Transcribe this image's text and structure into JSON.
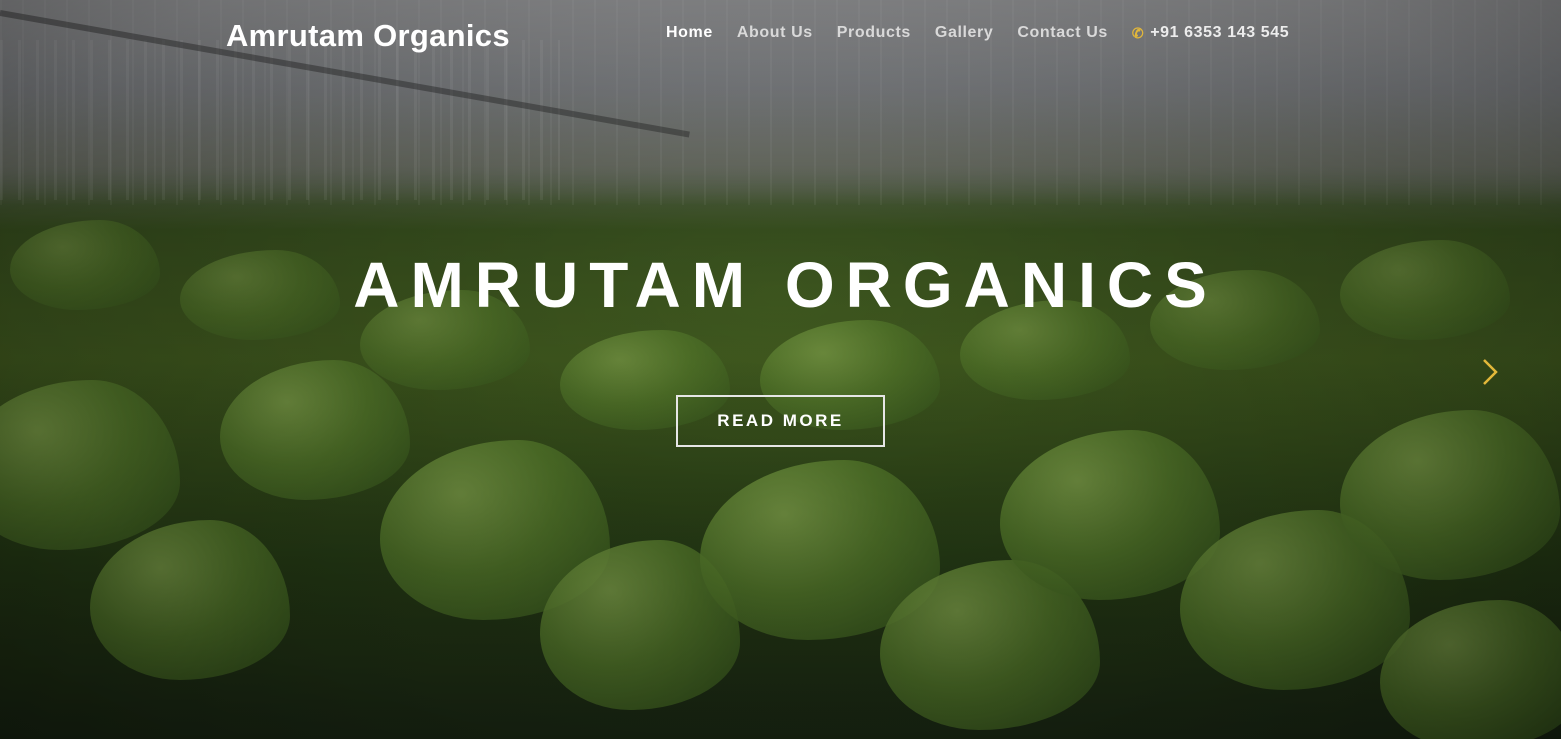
{
  "header": {
    "brand": "Amrutam Organics",
    "nav": [
      {
        "label": "Home",
        "active": true
      },
      {
        "label": "About Us",
        "active": false
      },
      {
        "label": "Products",
        "active": false
      },
      {
        "label": "Gallery",
        "active": false
      },
      {
        "label": "Contact Us",
        "active": false
      }
    ],
    "phone": "+91 6353 143 545",
    "phone_icon": "phone-icon"
  },
  "hero": {
    "title": "AMRUTAM ORGANICS",
    "button_label": "READ MORE",
    "next_icon": "chevron-right-icon"
  },
  "colors": {
    "accent": "#e2b73a",
    "text": "#ffffff",
    "nav_text": "#d9d9d9"
  }
}
